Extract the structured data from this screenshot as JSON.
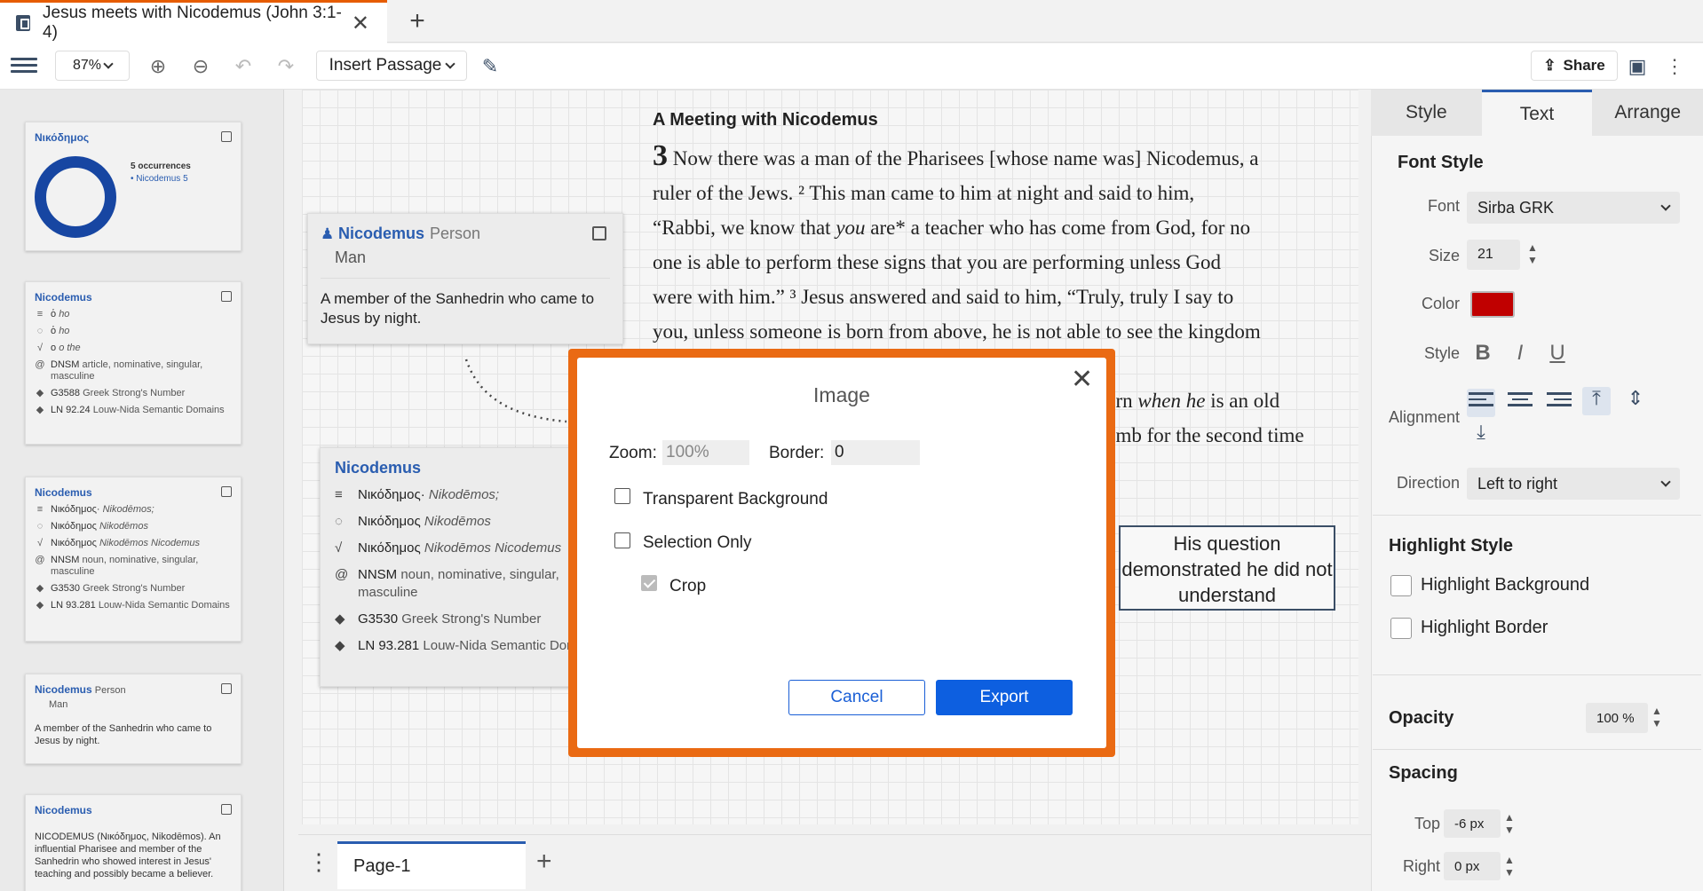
{
  "tab": {
    "title": "Jesus meets with Nicodemus (John 3:1-4)"
  },
  "toolbar": {
    "zoom": "87%",
    "insert_label": "Insert Passage",
    "share_label": "Share"
  },
  "sidebar": {
    "card1": {
      "title": "Νικόδημος",
      "occurrences": "5 occurrences",
      "legend": "• Nicodemus 5"
    },
    "card2": {
      "title": "Nicodemus",
      "rows": [
        {
          "icon": "≡",
          "text": "ὁ",
          "it": "ho"
        },
        {
          "icon": "◌",
          "text": "ὁ",
          "it": "ho"
        },
        {
          "icon": "√",
          "text": "ο",
          "it": "o the"
        },
        {
          "icon": "@",
          "text": "DNSM",
          "it": "article, nominative, singular, masculine"
        },
        {
          "icon": "◆",
          "text": "G3588",
          "it": "Greek Strong's Number"
        },
        {
          "icon": "◆",
          "text": "LN 92.24",
          "it": "Louw-Nida Semantic Domains"
        }
      ]
    },
    "card3": {
      "title": "Nicodemus",
      "rows": [
        {
          "icon": "≡",
          "text": "Νικόδημος·",
          "it": "Nikodēmos;"
        },
        {
          "icon": "◌",
          "text": "Νικόδημος",
          "it": "Nikodēmos"
        },
        {
          "icon": "√",
          "text": "Νικόδημος",
          "it": "Nikodēmos Nicodemus"
        },
        {
          "icon": "@",
          "text": "NNSM",
          "it": "noun, nominative, singular, masculine"
        },
        {
          "icon": "◆",
          "text": "G3530",
          "it": "Greek Strong's Number"
        },
        {
          "icon": "◆",
          "text": "LN 93.281",
          "it": "Louw-Nida Semantic Domains"
        }
      ]
    },
    "card4": {
      "title": "Nicodemus",
      "type": "Person",
      "sub": "Man",
      "desc": "A member of the Sanhedrin who came to Jesus by night."
    },
    "card5": {
      "title": "Nicodemus",
      "desc": "NICODEMUS (Νικόδημος, Nikodēmos). An influential Pharisee and member of the Sanhedrin who showed interest in Jesus' teaching and possibly became a believer."
    }
  },
  "canvas": {
    "heading": "A Meeting with Nicodemus",
    "chapter": "3",
    "line1": "Now there was a man of the Pharisees [whose name was] Nicodemus, a",
    "line2": "ruler of the Jews. ² This man came to him at night and said to him,",
    "line3a": "“Rabbi, we know that ",
    "line3em": "you",
    "line3b": " are* a teacher who has come from God, for no",
    "line4": "one is able to perform these signs that you are performing unless God",
    "line5": "were with him.” ³ Jesus answered and said to him, “Truly, truly I say to",
    "line6": "you, unless someone is born from above, he is not able to see the kingdom",
    "line7a": "orn ",
    "line7em": "when he",
    "line7b": " is an old",
    "line8": "omb for the second time",
    "person_card": {
      "name": "Nicodemus",
      "type": "Person",
      "sub": "Man",
      "desc": "A member of the Sanhedrin who came to Jesus by night."
    },
    "word_card": {
      "name": "Nicodemus",
      "rows": [
        {
          "icon": "≡",
          "text": "Νικόδημος·",
          "it": "Nikodēmos;"
        },
        {
          "icon": "◌",
          "text": "Νικόδημος",
          "it": "Nikodēmos"
        },
        {
          "icon": "√",
          "text": "Νικόδημος",
          "it": "Nikodēmos Nicodemus"
        },
        {
          "icon": "@",
          "text": "NNSM",
          "it": "noun, nominative, singular, masculine"
        },
        {
          "icon": "◆",
          "text": "G3530",
          "it": "Greek Strong's Number"
        },
        {
          "icon": "◆",
          "text": "LN 93.281",
          "it": "Louw-Nida Semantic Domains"
        }
      ]
    },
    "note": "His question demonstrated he did not understand"
  },
  "pages": {
    "current": "Page-1"
  },
  "right_panel": {
    "tabs": [
      "Style",
      "Text",
      "Arrange"
    ],
    "font_style": "Font Style",
    "font_label": "Font",
    "font_value": "Sirba GRK",
    "size_label": "Size",
    "size_value": "21",
    "color_label": "Color",
    "color_value": "#c00000",
    "style_label": "Style",
    "alignment_label": "Alignment",
    "direction_label": "Direction",
    "direction_value": "Left to right",
    "highlight_style": "Highlight Style",
    "highlight_bg": "Highlight Background",
    "highlight_border": "Highlight Border",
    "opacity_label": "Opacity",
    "opacity_value": "100 %",
    "spacing": "Spacing",
    "top_label": "Top",
    "top_value": "-6 px",
    "right_label": "Right",
    "right_value": "0 px"
  },
  "dialog": {
    "title": "Image",
    "zoom_label": "Zoom:",
    "zoom_value": "100%",
    "border_label": "Border:",
    "border_value": "0",
    "transparent_label": "Transparent Background",
    "selection_label": "Selection Only",
    "crop_label": "Crop",
    "cancel_label": "Cancel",
    "export_label": "Export"
  }
}
